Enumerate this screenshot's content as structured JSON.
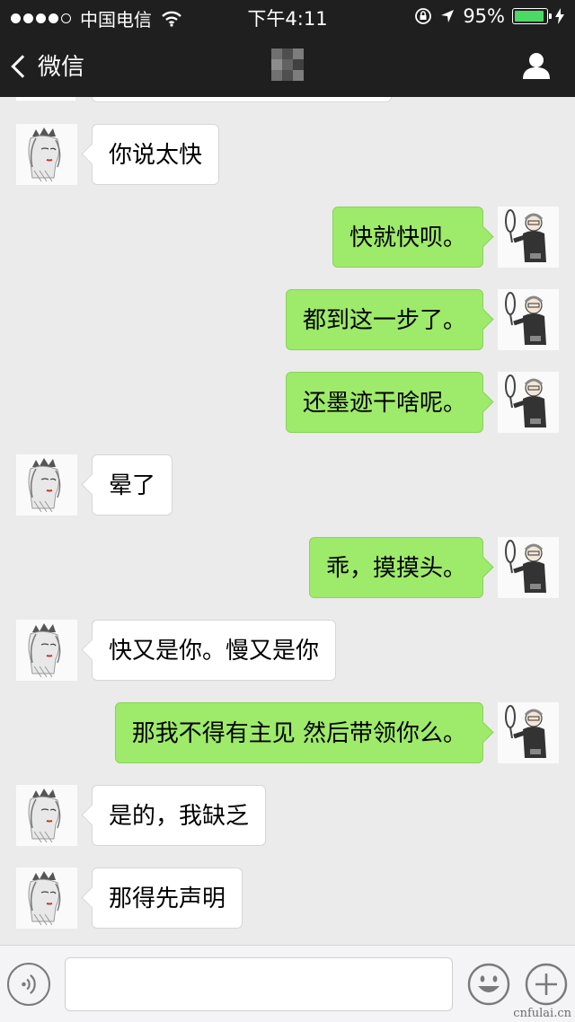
{
  "status_bar": {
    "carrier": "中国电信",
    "time": "下午4:11",
    "battery": "95%",
    "signal_bars_filled": 4,
    "signal_bars_total": 5
  },
  "nav": {
    "back_label": "微信",
    "back_icon": "chevron-left-icon",
    "profile_icon": "person-icon"
  },
  "messages": [
    {
      "side": "left",
      "text": "你说太快"
    },
    {
      "side": "right",
      "text": "快就快呗。"
    },
    {
      "side": "right",
      "text": "都到这一步了。"
    },
    {
      "side": "right",
      "text": "还墨迹干啥呢。"
    },
    {
      "side": "left",
      "text": "晕了"
    },
    {
      "side": "right",
      "text": "乖，摸摸头。"
    },
    {
      "side": "left",
      "text": "快又是你。慢又是你"
    },
    {
      "side": "right",
      "text": "那我不得有主见 然后带领你么。"
    },
    {
      "side": "left",
      "text": "是的，我缺乏"
    },
    {
      "side": "left",
      "text": "那得先声明"
    }
  ],
  "input_bar": {
    "text_value": "",
    "voice_icon": "voice-icon",
    "emoji_icon": "emoji-icon",
    "plus_icon": "plus-icon"
  },
  "watermark": "cnfulai.cn",
  "colors": {
    "nav_background": "#1f1f1f",
    "chat_background": "#ebebeb",
    "sent_bubble": "#9eea6a",
    "received_bubble": "#ffffff",
    "battery_fill": "#4cd964"
  }
}
